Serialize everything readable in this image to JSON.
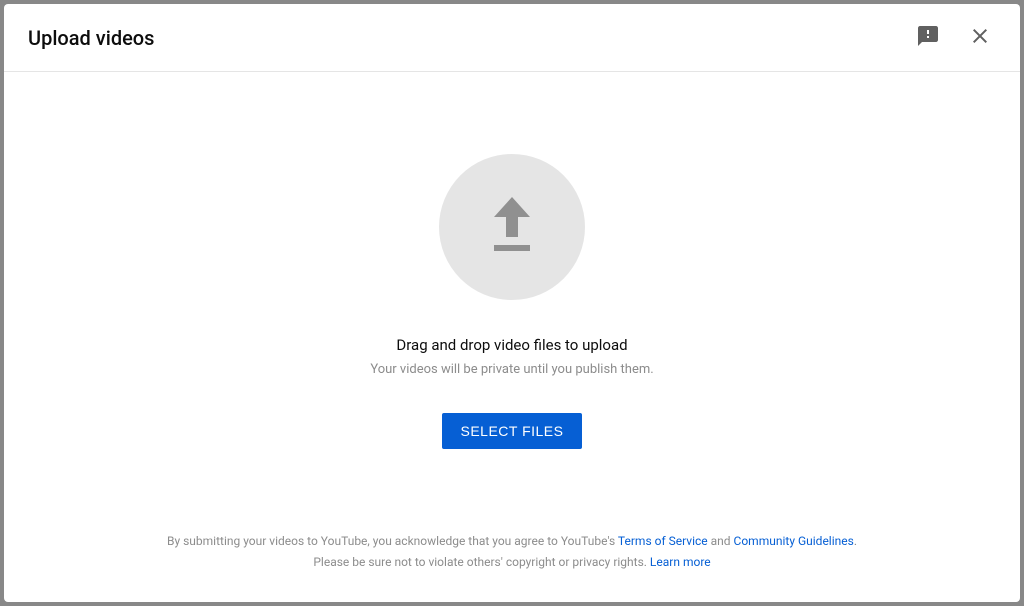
{
  "header": {
    "title": "Upload videos"
  },
  "main": {
    "drag_text": "Drag and drop video files to upload",
    "privacy_text": "Your videos will be private until you publish them.",
    "select_button": "SELECT FILES"
  },
  "footer": {
    "line1_part1": "By submitting your videos to YouTube, you acknowledge that you agree to YouTube's ",
    "terms_link": "Terms of Service",
    "line1_part2": " and ",
    "guidelines_link": "Community Guidelines",
    "line1_part3": ".",
    "line2_part1": "Please be sure not to violate others' copyright or privacy rights. ",
    "learn_more_link": "Learn more"
  }
}
